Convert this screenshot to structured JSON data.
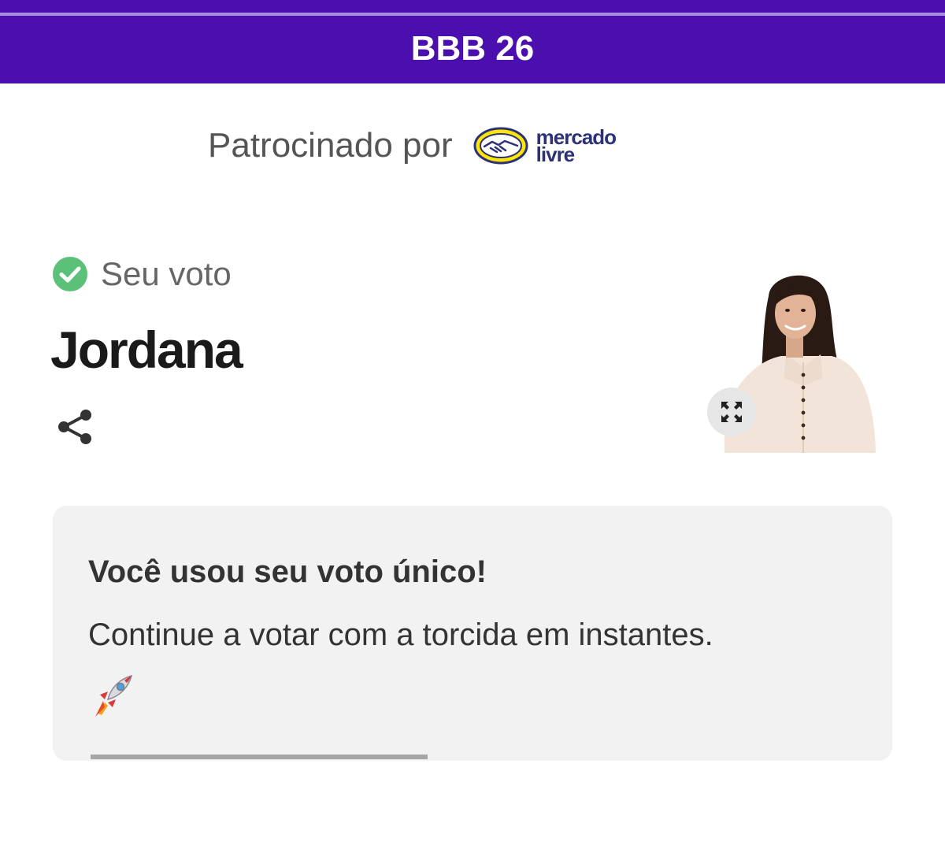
{
  "header": {
    "title": "BBB 26",
    "background_color": "#4b0fb0"
  },
  "sponsor": {
    "label": "Patrocinado por",
    "logo_name": "mercado-livre-logo",
    "logo_line1": "mercado",
    "logo_line2": "livre"
  },
  "vote": {
    "status_label": "Seu voto",
    "status_icon": "check-circle-icon",
    "status_color": "#5cc178",
    "candidate_name": "Jordana",
    "share_icon": "share-icon",
    "expand_icon": "expand-icon"
  },
  "message_card": {
    "title": "Você usou seu voto único!",
    "text": "Continue a votar com a torcida em instantes.",
    "emoji": "🚀",
    "progress": 0.42
  }
}
